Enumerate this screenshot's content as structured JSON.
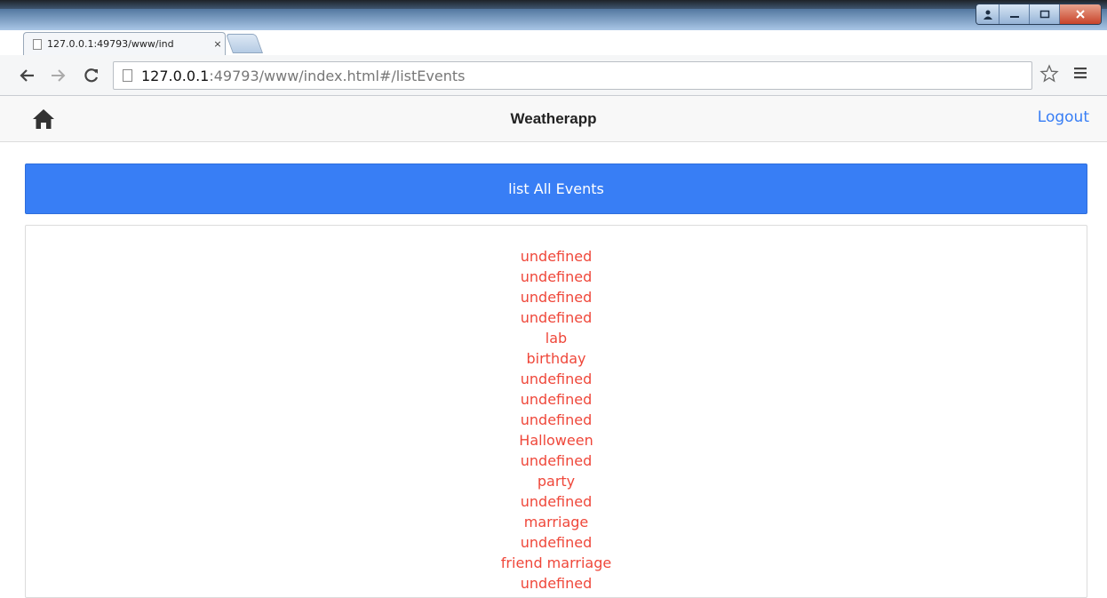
{
  "browser": {
    "tab_title": "127.0.0.1:49793/www/ind",
    "tab_close": "×",
    "url_host": "127.0.0.1",
    "url_rest": ":49793/www/index.html#/listEvents",
    "icons": {
      "back": "arrow-left-icon",
      "forward": "arrow-right-icon",
      "reload": "reload-icon",
      "bookmark": "star-icon",
      "menu": "hamburger-menu-icon"
    }
  },
  "header": {
    "title": "Weatherapp",
    "logout_label": "Logout",
    "home_icon": "home-icon"
  },
  "main": {
    "list_button_label": "list All Events",
    "events": [
      "undefined",
      "undefined",
      "undefined",
      "undefined",
      "lab",
      "birthday",
      "undefined",
      "undefined",
      "undefined",
      "Halloween",
      "undefined",
      "party",
      "undefined",
      "marriage",
      "undefined",
      "friend marriage",
      "undefined"
    ]
  },
  "colors": {
    "primary": "#387ef5",
    "event_text": "#ef473a",
    "header_bg": "#f8f8f8"
  }
}
